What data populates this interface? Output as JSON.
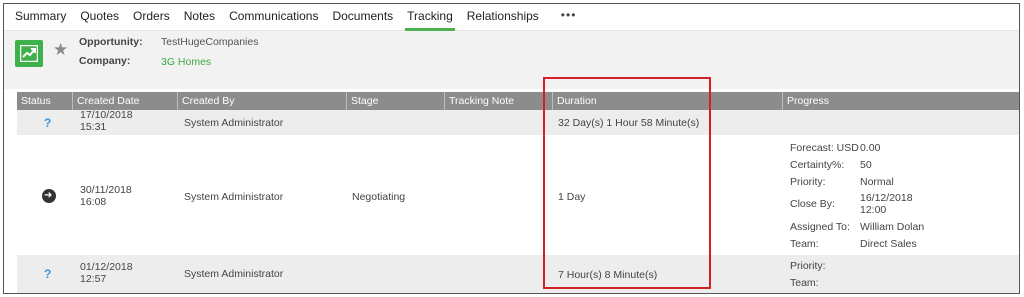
{
  "tabs": [
    {
      "label": "Summary"
    },
    {
      "label": "Quotes"
    },
    {
      "label": "Orders"
    },
    {
      "label": "Notes"
    },
    {
      "label": "Communications"
    },
    {
      "label": "Documents"
    },
    {
      "label": "Tracking",
      "active": true
    },
    {
      "label": "Relationships"
    }
  ],
  "tabs_more": "•••",
  "header": {
    "opportunity_label": "Opportunity:",
    "opportunity_value": "TestHugeCompanies",
    "company_label": "Company:",
    "company_value": "3G Homes"
  },
  "grid": {
    "columns": [
      "Status",
      "Created Date",
      "Created By",
      "Stage",
      "Tracking Note",
      "Duration",
      "Progress"
    ],
    "rows": [
      {
        "status_icon": "question-mark-icon",
        "status_text": "?",
        "date": "17/10/2018",
        "time": "15:31",
        "created_by": "System Administrator",
        "stage": "",
        "tracking_note": "",
        "duration": "32 Day(s) 1 Hour 58 Minute(s)"
      },
      {
        "status_icon": "arrow-circle-icon",
        "date": "30/11/2018",
        "time": "16:08",
        "created_by": "System Administrator",
        "stage": "Negotiating",
        "tracking_note": "",
        "duration": "1 Day",
        "progress": {
          "forecast_label": "Forecast: USD",
          "forecast_value": "0.00",
          "certainty_label": "Certainty%:",
          "certainty_value": "50",
          "priority_label": "Priority:",
          "priority_value": "Normal",
          "close_by_label": "Close By:",
          "close_by_date": "16/12/2018",
          "close_by_time": "12:00",
          "assigned_label": "Assigned To:",
          "assigned_value": "William Dolan",
          "team_label": "Team:",
          "team_value": "Direct Sales"
        }
      },
      {
        "status_icon": "question-mark-icon",
        "status_text": "?",
        "date": "01/12/2018",
        "time": "12:57",
        "created_by": "System Administrator",
        "stage": "",
        "tracking_note": "",
        "duration": "7 Hour(s) 8 Minute(s)",
        "progress": {
          "priority_label": "Priority:",
          "team_label": "Team:"
        }
      }
    ]
  },
  "colors": {
    "accent_green": "#4caf50",
    "link_green": "#3aa843",
    "grid_header": "#8c8c8c",
    "highlight_red": "#d51f26",
    "status_blue": "#3a95d6"
  }
}
